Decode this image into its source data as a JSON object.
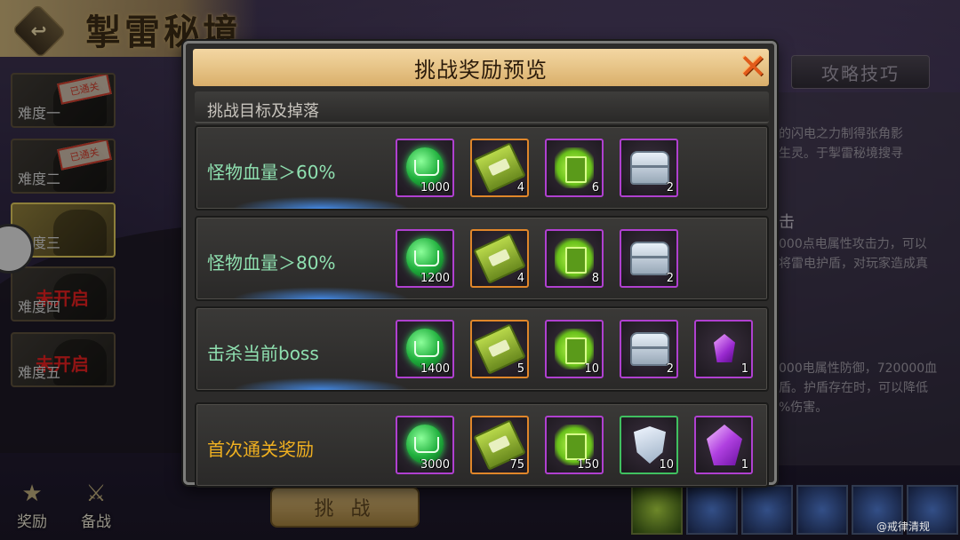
{
  "header": {
    "title": "掣雷秘境",
    "back_icon": "back-arrow-icon"
  },
  "difficulties": [
    {
      "label": "难度一",
      "stamp": "已通关",
      "status": "cleared"
    },
    {
      "label": "难度二",
      "stamp": "已通关",
      "status": "cleared"
    },
    {
      "label": "难度三",
      "stamp": "",
      "status": "selected"
    },
    {
      "label": "难度四",
      "locked_text": "未开启",
      "status": "locked"
    },
    {
      "label": "难度五",
      "locked_text": "未开启",
      "status": "locked"
    }
  ],
  "side_badge": "",
  "right_panel": {
    "tab_label": "攻略技巧",
    "lines_top": [
      "的闪电之力制得张角影",
      "生灵。于掣雷秘境搜寻"
    ],
    "heading": "击",
    "lines_mid": [
      "000点电属性攻击力，可以",
      "将雷电护盾，对玩家造成真"
    ],
    "lines_bottom": [
      "000电属性防御，720000血",
      "盾。护盾存在时，可以降低",
      "%伤害。"
    ]
  },
  "bottom": {
    "reward_label": "奖励",
    "prepare_label": "备战",
    "challenge_label": "挑 战"
  },
  "watermark": "@戒律清规",
  "modal": {
    "title": "挑战奖励预览",
    "section_title": "挑战目标及掉落",
    "rows": [
      {
        "label": "怪物血量＞60%",
        "items": [
          {
            "icon": "green-book-icon",
            "rarity": "purple",
            "count": "1000"
          },
          {
            "icon": "green-scroll-icon",
            "rarity": "orange",
            "count": "4"
          },
          {
            "icon": "green-tome-icon",
            "rarity": "purple",
            "count": "6"
          },
          {
            "icon": "silver-chest-icon",
            "rarity": "purple",
            "count": "2"
          }
        ]
      },
      {
        "label": "怪物血量＞80%",
        "items": [
          {
            "icon": "green-book-icon",
            "rarity": "purple",
            "count": "1200"
          },
          {
            "icon": "green-scroll-icon",
            "rarity": "orange",
            "count": "4"
          },
          {
            "icon": "green-tome-icon",
            "rarity": "purple",
            "count": "8"
          },
          {
            "icon": "silver-chest-icon",
            "rarity": "purple",
            "count": "2"
          }
        ]
      },
      {
        "label": "击杀当前boss",
        "items": [
          {
            "icon": "green-book-icon",
            "rarity": "purple",
            "count": "1400"
          },
          {
            "icon": "green-scroll-icon",
            "rarity": "orange",
            "count": "5"
          },
          {
            "icon": "green-tome-icon",
            "rarity": "purple",
            "count": "10"
          },
          {
            "icon": "silver-chest-icon",
            "rarity": "purple",
            "count": "2"
          },
          {
            "icon": "purple-gem-icon",
            "rarity": "purple",
            "count": "1"
          }
        ]
      }
    ],
    "first_clear": {
      "label": "首次通关奖励",
      "items": [
        {
          "icon": "green-book-icon",
          "rarity": "purple",
          "count": "3000"
        },
        {
          "icon": "green-scroll-icon",
          "rarity": "orange",
          "count": "75"
        },
        {
          "icon": "green-tome-icon",
          "rarity": "purple",
          "count": "150"
        },
        {
          "icon": "silver-shield-icon",
          "rarity": "green",
          "count": "10"
        },
        {
          "icon": "purple-crystal-icon",
          "rarity": "purple",
          "count": "1"
        }
      ]
    }
  },
  "colors": {
    "modal_header": "#e8c68a",
    "row_label": "#8fe0b0",
    "first_clear_label": "#f0b020",
    "rarity_purple": "#b040d0",
    "rarity_orange": "#e0862a",
    "rarity_green": "#40c060",
    "close_icon": "#e15a1a"
  }
}
